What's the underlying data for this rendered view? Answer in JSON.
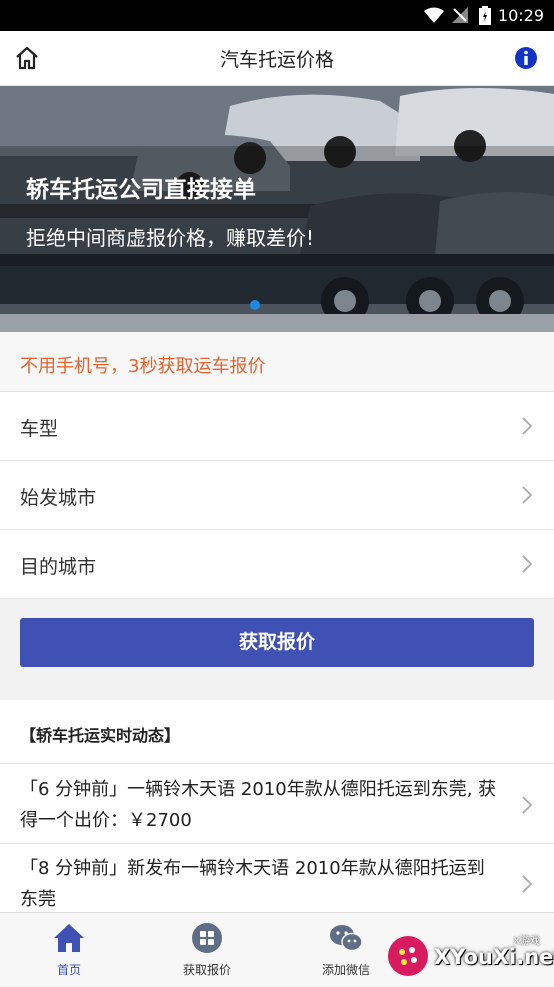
{
  "status_bar": {
    "time": "10:29"
  },
  "header": {
    "title": "汽车托运价格"
  },
  "banner": {
    "headline": "轿车托运公司直接接单",
    "subline": "拒绝中间商虚报价格，赚取差价!"
  },
  "promo": {
    "text": "不用手机号，3秒获取运车报价"
  },
  "form": {
    "rows": [
      {
        "label": "车型"
      },
      {
        "label": "始发城市"
      },
      {
        "label": "目的城市"
      }
    ],
    "submit_label": "获取报价"
  },
  "news": {
    "title": "【轿车托运实时动态】",
    "items": [
      {
        "text": "「6 分钟前」一辆铃木天语 2010年款从德阳托运到东莞, 获得一个出价：￥2700"
      },
      {
        "text": "「8 分钟前」新发布一辆铃木天语 2010年款从德阳托运到东莞"
      }
    ]
  },
  "tabbar": {
    "tabs": [
      {
        "label": "首页",
        "icon": "home-icon",
        "active": true
      },
      {
        "label": "获取报价",
        "icon": "grid-icon",
        "active": false
      },
      {
        "label": "添加微信",
        "icon": "wechat-icon",
        "active": false
      }
    ]
  },
  "watermark": {
    "text": "XYouXi.net",
    "tag": "X游戏"
  },
  "colors": {
    "primary": "#3f51b5",
    "promo_text": "#e8612c",
    "active_tab": "#3f51b5"
  }
}
